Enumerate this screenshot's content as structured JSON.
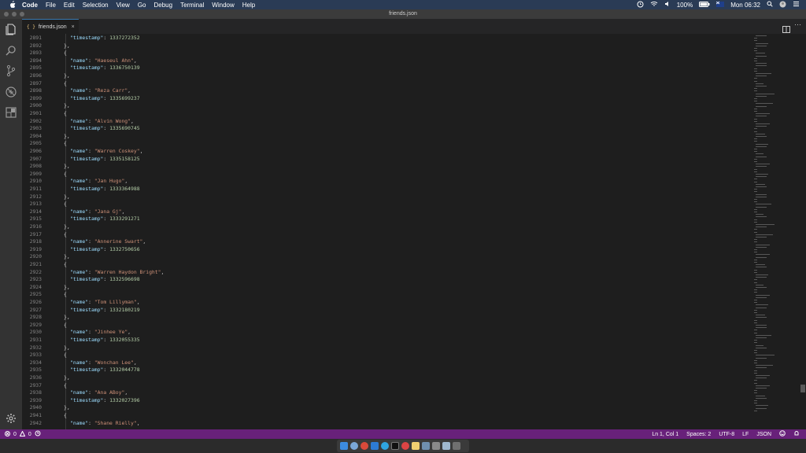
{
  "menubar": {
    "app_name": "Code",
    "items": [
      "File",
      "Edit",
      "Selection",
      "View",
      "Go",
      "Debug",
      "Terminal",
      "Window",
      "Help"
    ],
    "battery": "100%",
    "clock": "Mon 06:32"
  },
  "window": {
    "title": "friends.json"
  },
  "tab": {
    "icon_text": "{ }",
    "label": "friends.json",
    "close": "×"
  },
  "tabs_more": "···",
  "editor": {
    "lines": [
      {
        "ln": "2891",
        "indent": 2,
        "key": "timestamp",
        "value": "1337272352",
        "type": "number",
        "trail": ""
      },
      {
        "ln": "2892",
        "indent": 1,
        "text": "},"
      },
      {
        "ln": "2893",
        "indent": 1,
        "text": "{"
      },
      {
        "ln": "2894",
        "indent": 2,
        "key": "name",
        "value": "Haeseul Ahn",
        "type": "string",
        "trail": ","
      },
      {
        "ln": "2895",
        "indent": 2,
        "key": "timestamp",
        "value": "1336750139",
        "type": "number",
        "trail": ""
      },
      {
        "ln": "2896",
        "indent": 1,
        "text": "},"
      },
      {
        "ln": "2897",
        "indent": 1,
        "text": "{"
      },
      {
        "ln": "2898",
        "indent": 2,
        "key": "name",
        "value": "Reza Carr",
        "type": "string",
        "trail": ","
      },
      {
        "ln": "2899",
        "indent": 2,
        "key": "timestamp",
        "value": "1335699237",
        "type": "number",
        "trail": ""
      },
      {
        "ln": "2900",
        "indent": 1,
        "text": "},"
      },
      {
        "ln": "2901",
        "indent": 1,
        "text": "{"
      },
      {
        "ln": "2902",
        "indent": 2,
        "key": "name",
        "value": "Alvin Wong",
        "type": "string",
        "trail": ","
      },
      {
        "ln": "2903",
        "indent": 2,
        "key": "timestamp",
        "value": "1335690745",
        "type": "number",
        "trail": ""
      },
      {
        "ln": "2904",
        "indent": 1,
        "text": "},"
      },
      {
        "ln": "2905",
        "indent": 1,
        "text": "{"
      },
      {
        "ln": "2906",
        "indent": 2,
        "key": "name",
        "value": "Warren Coskey",
        "type": "string",
        "trail": ","
      },
      {
        "ln": "2907",
        "indent": 2,
        "key": "timestamp",
        "value": "1335158125",
        "type": "number",
        "trail": ""
      },
      {
        "ln": "2908",
        "indent": 1,
        "text": "},"
      },
      {
        "ln": "2909",
        "indent": 1,
        "text": "{"
      },
      {
        "ln": "2910",
        "indent": 2,
        "key": "name",
        "value": "Jan Hugo",
        "type": "string",
        "trail": ","
      },
      {
        "ln": "2911",
        "indent": 2,
        "key": "timestamp",
        "value": "1333364988",
        "type": "number",
        "trail": ""
      },
      {
        "ln": "2912",
        "indent": 1,
        "text": "},"
      },
      {
        "ln": "2913",
        "indent": 1,
        "text": "{"
      },
      {
        "ln": "2914",
        "indent": 2,
        "key": "name",
        "value": "Jana Gj",
        "type": "string",
        "trail": ","
      },
      {
        "ln": "2915",
        "indent": 2,
        "key": "timestamp",
        "value": "1333291271",
        "type": "number",
        "trail": ""
      },
      {
        "ln": "2916",
        "indent": 1,
        "text": "},"
      },
      {
        "ln": "2917",
        "indent": 1,
        "text": "{"
      },
      {
        "ln": "2918",
        "indent": 2,
        "key": "name",
        "value": "Annerine Swart",
        "type": "string",
        "trail": ","
      },
      {
        "ln": "2919",
        "indent": 2,
        "key": "timestamp",
        "value": "1332750656",
        "type": "number",
        "trail": ""
      },
      {
        "ln": "2920",
        "indent": 1,
        "text": "},"
      },
      {
        "ln": "2921",
        "indent": 1,
        "text": "{"
      },
      {
        "ln": "2922",
        "indent": 2,
        "key": "name",
        "value": "Warren Haydon Bright",
        "type": "string",
        "trail": ","
      },
      {
        "ln": "2923",
        "indent": 2,
        "key": "timestamp",
        "value": "1332596698",
        "type": "number",
        "trail": ""
      },
      {
        "ln": "2924",
        "indent": 1,
        "text": "},"
      },
      {
        "ln": "2925",
        "indent": 1,
        "text": "{"
      },
      {
        "ln": "2926",
        "indent": 2,
        "key": "name",
        "value": "Tom Lillyman",
        "type": "string",
        "trail": ","
      },
      {
        "ln": "2927",
        "indent": 2,
        "key": "timestamp",
        "value": "1332180219",
        "type": "number",
        "trail": ""
      },
      {
        "ln": "2928",
        "indent": 1,
        "text": "},"
      },
      {
        "ln": "2929",
        "indent": 1,
        "text": "{"
      },
      {
        "ln": "2930",
        "indent": 2,
        "key": "name",
        "value": "Jinhee Ye",
        "type": "string",
        "trail": ","
      },
      {
        "ln": "2931",
        "indent": 2,
        "key": "timestamp",
        "value": "1332055335",
        "type": "number",
        "trail": ""
      },
      {
        "ln": "2932",
        "indent": 1,
        "text": "},"
      },
      {
        "ln": "2933",
        "indent": 1,
        "text": "{"
      },
      {
        "ln": "2934",
        "indent": 2,
        "key": "name",
        "value": "Wonchan Lee",
        "type": "string",
        "trail": ","
      },
      {
        "ln": "2935",
        "indent": 2,
        "key": "timestamp",
        "value": "1332044778",
        "type": "number",
        "trail": ""
      },
      {
        "ln": "2936",
        "indent": 1,
        "text": "},"
      },
      {
        "ln": "2937",
        "indent": 1,
        "text": "{"
      },
      {
        "ln": "2938",
        "indent": 2,
        "key": "name",
        "value": "Ana ABoy",
        "type": "string",
        "trail": ","
      },
      {
        "ln": "2939",
        "indent": 2,
        "key": "timestamp",
        "value": "1332027396",
        "type": "number",
        "trail": ""
      },
      {
        "ln": "2940",
        "indent": 1,
        "text": "},"
      },
      {
        "ln": "2941",
        "indent": 1,
        "text": "{"
      },
      {
        "ln": "2942",
        "indent": 2,
        "key": "name",
        "value": "Shane Rielly",
        "type": "string",
        "trail": ","
      }
    ]
  },
  "statusbar": {
    "errors": "0",
    "warnings": "0",
    "cursor": "Ln 1, Col 1",
    "spaces": "Spaces: 2",
    "encoding": "UTF-8",
    "eol": "LF",
    "language": "JSON"
  },
  "colors": {
    "statusbar": "#68217a",
    "menubar": "#2a3b55",
    "json_key": "#9cdcfe",
    "json_string": "#ce9178",
    "json_number": "#b5cea8"
  }
}
